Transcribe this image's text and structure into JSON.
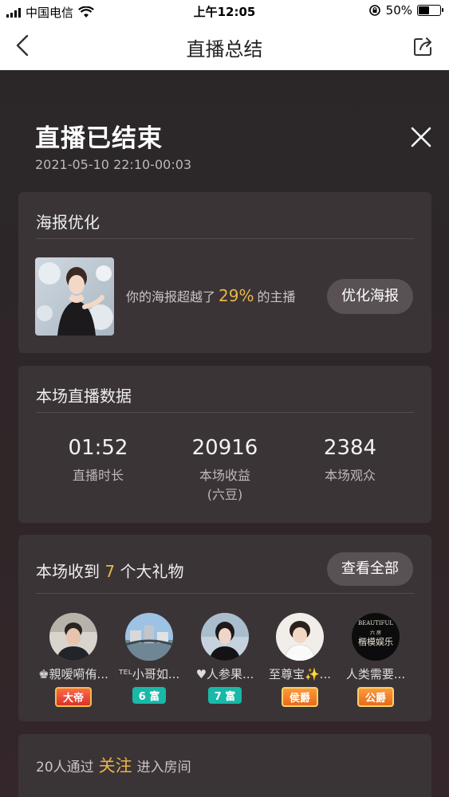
{
  "status_bar": {
    "carrier": "中国电信",
    "time": "上午12:05",
    "battery": "50%",
    "battery_level": 0.5
  },
  "nav": {
    "title": "直播总结"
  },
  "summary": {
    "title": "直播已结束",
    "time_range": "2021-05-10 22:10-00:03"
  },
  "poster": {
    "heading": "海报优化",
    "text_before": "你的海报超越了",
    "percent": "29%",
    "text_after": "的主播",
    "button": "优化海报"
  },
  "stats": {
    "heading": "本场直播数据",
    "items": [
      {
        "value": "01:52",
        "label": "直播时长",
        "sub": ""
      },
      {
        "value": "20916",
        "label": "本场收益",
        "sub": "(六豆)"
      },
      {
        "value": "2384",
        "label": "本场观众",
        "sub": ""
      }
    ]
  },
  "gifts": {
    "heading_before": "本场收到",
    "count": "7",
    "heading_after": "个大礼物",
    "view_all": "查看全部",
    "givers": [
      {
        "name": "♚親嗳嗬侑...",
        "badge": "大帝"
      },
      {
        "name": "ᵀᴱᴸ小哥如...",
        "badge": "6 富"
      },
      {
        "name": "♥人参果...",
        "badge": "7 富"
      },
      {
        "name": "至尊宝✨...",
        "badge": "侯爵"
      },
      {
        "name": "人类需要...",
        "badge": "公爵",
        "avatar_text_top": "BEAUTIFUL",
        "avatar_text_mid": "六 房",
        "avatar_text_main": "楷模娱乐"
      }
    ]
  },
  "follow": {
    "text_before": "20人通过",
    "highlight": "关注",
    "text_after": "进入房间"
  }
}
